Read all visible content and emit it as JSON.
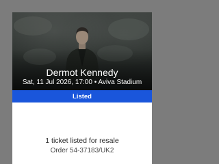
{
  "event": {
    "artist": "Dermot Kennedy",
    "details": "Sat, 11 Jul 2026, 17:00 • Aviva Stadium"
  },
  "ticket": {
    "status": "Listed",
    "status_color": "#1a56db",
    "resale_text": "1 ticket listed for resale",
    "order_text": "Order 54-37183/UK2"
  }
}
